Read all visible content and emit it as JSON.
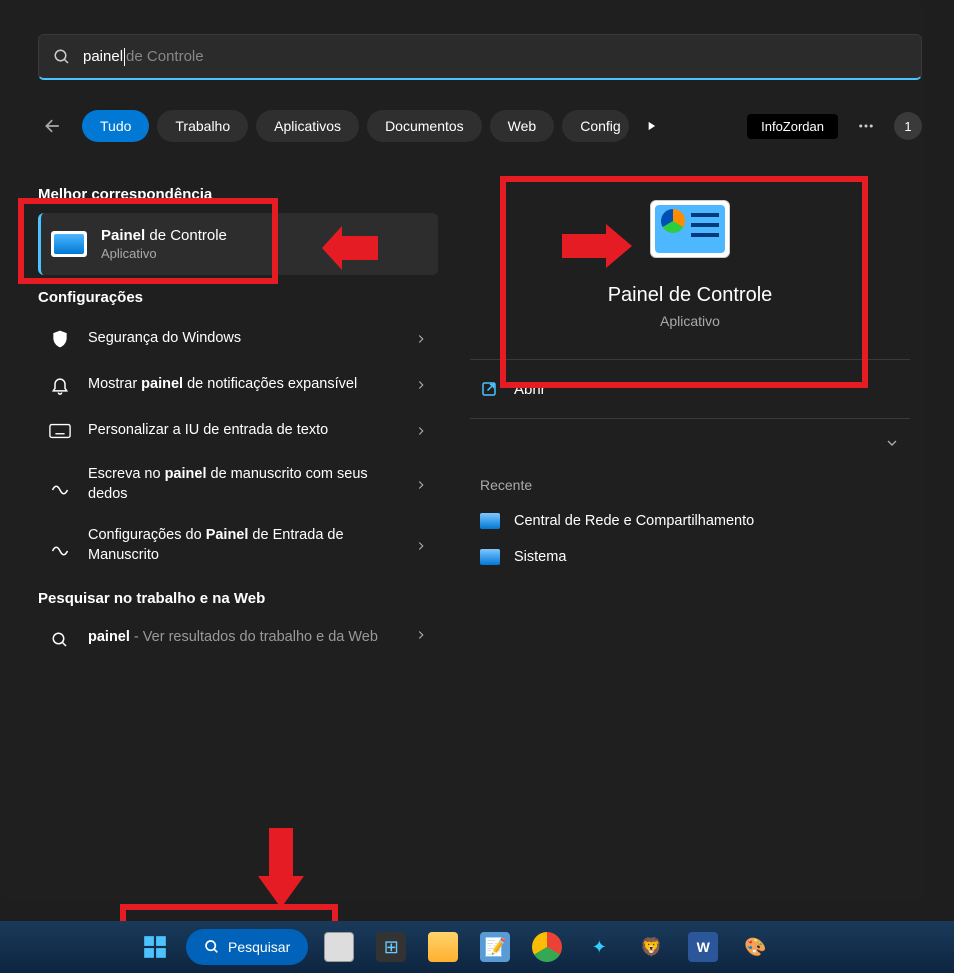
{
  "search": {
    "typed": "painel",
    "ghost": " de Controle"
  },
  "tabs": {
    "t0": "Tudo",
    "t1": "Trabalho",
    "t2": "Aplicativos",
    "t3": "Documentos",
    "t4": "Web",
    "t5": "Config"
  },
  "brand": "InfoZordan",
  "avatar": "1",
  "sections": {
    "best": "Melhor correspondência",
    "settings": "Configurações",
    "web": "Pesquisar no trabalho e na Web"
  },
  "bestMatch": {
    "title_bold": "Painel",
    "title_rest": " de Controle",
    "sub": "Aplicativo"
  },
  "settings": [
    {
      "text": "Segurança do Windows",
      "bold": ""
    },
    {
      "pre": "Mostrar ",
      "bold": "painel",
      "post": " de notificações expansível"
    },
    {
      "text": "Personalizar a IU de entrada de texto"
    },
    {
      "pre": "Escreva no ",
      "bold": "painel",
      "post": " de manuscrito com seus dedos"
    },
    {
      "pre": "Configurações do ",
      "bold": "Painel",
      "post": " de Entrada de Manuscrito"
    }
  ],
  "webResult": {
    "bold": "painel",
    "rest": " - Ver resultados do trabalho e da Web"
  },
  "preview": {
    "title": "Painel de Controle",
    "sub": "Aplicativo",
    "open": "Abrir",
    "recent": "Recente"
  },
  "recent": {
    "r0": "Central de Rede e Compartilhamento",
    "r1": "Sistema"
  },
  "taskbar": {
    "search": "Pesquisar"
  }
}
